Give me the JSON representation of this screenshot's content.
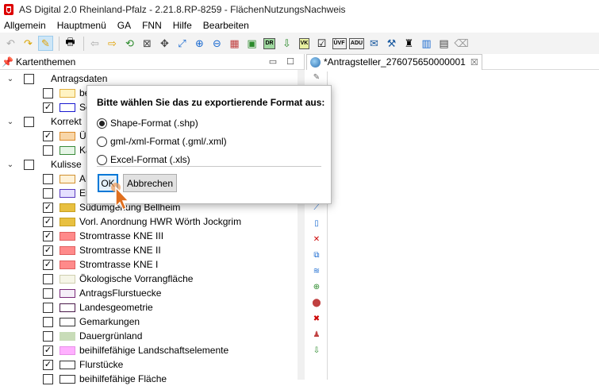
{
  "window": {
    "title": "AS Digital 2.0 Rheinland-Pfalz - 2.21.8.RP-8259 - FlächenNutzungsNachweis"
  },
  "menu": [
    "Allgemein",
    "Hauptmenü",
    "GA",
    "FNN",
    "Hilfe",
    "Bearbeiten"
  ],
  "toolbar": {
    "icons": [
      "undo-icon",
      "redo-icon",
      "pencil-icon",
      "print-icon",
      "back-icon",
      "forward-icon",
      "refresh-icon",
      "select-icon",
      "pan-icon",
      "fit-icon",
      "zoom-in-icon",
      "zoom-out-icon",
      "layers-icon",
      "colors-icon",
      "dr-icon",
      "export-icon",
      "vk-icon",
      "checklist-icon",
      "upload-icon",
      "adu-icon",
      "mail-icon",
      "tools-icon",
      "bug-icon",
      "map-icon",
      "save-icon",
      "eraser-icon"
    ],
    "badges": {
      "dr": "DR",
      "vk": "VK",
      "ouf": "ÜVF",
      "adu": "ADU"
    }
  },
  "left_panel": {
    "title": "Kartenthemen",
    "groups": [
      {
        "label": "Antragsdaten",
        "checked": false
      },
      {
        "label": "Korrekt",
        "checked": false
      },
      {
        "label": "Kulisse",
        "checked": false
      }
    ],
    "items": [
      {
        "label": "be",
        "checked": false,
        "color": "#fff3c2",
        "border": "#e0b040"
      },
      {
        "label": "Sc",
        "checked": true,
        "color": "#ffffff",
        "border": "#1a1ad0"
      },
      {
        "label": "Üb",
        "checked": true,
        "color": "#f8d6a8",
        "border": "#d98a2a"
      },
      {
        "label": "Ka",
        "checked": false,
        "color": "#e6f5e6",
        "border": "#3a8a3a"
      },
      {
        "label": "AU",
        "checked": false,
        "color": "#fff2d8",
        "border": "#d09030"
      },
      {
        "label": "Er",
        "checked": false,
        "color": "#e5e0ff",
        "border": "#5a3abf"
      },
      {
        "label": "Südumgehung Bellheim",
        "checked": true,
        "color": "#e8c040",
        "border": "#c8a020"
      },
      {
        "label": "Vorl. Anordnung HWR Wörth Jockgrim",
        "checked": true,
        "color": "#e8c040",
        "border": "#c8a020"
      },
      {
        "label": "Stromtrasse KNE III",
        "checked": true,
        "color": "#ff8a8a",
        "border": "#e06060"
      },
      {
        "label": "Stromtrasse KNE II",
        "checked": true,
        "color": "#ff8a8a",
        "border": "#e06060"
      },
      {
        "label": "Stromtrasse KNE I",
        "checked": true,
        "color": "#ff8a8a",
        "border": "#e06060"
      },
      {
        "label": "Ökologische Vorrangfläche",
        "checked": false,
        "color": "#f6f6e8",
        "border": "#cfcfb0"
      },
      {
        "label": "AntragsFlurstuecke",
        "checked": false,
        "color": "#f5eef8",
        "border": "#7a2a7a"
      },
      {
        "label": "Landesgeometrie",
        "checked": false,
        "color": "#ffffff",
        "border": "#4a1a4a"
      },
      {
        "label": "Gemarkungen",
        "checked": false,
        "color": "#ffffff",
        "border": "#333333"
      },
      {
        "label": "Dauergrünland",
        "checked": false,
        "color": "#c8dcb8",
        "border": "#c8dcb8"
      },
      {
        "label": "beihilfefähige Landschaftselemente",
        "checked": true,
        "color": "#ffb0ff",
        "border": "#e890e8"
      },
      {
        "label": "Flurstücke",
        "checked": true,
        "color": "#ffffff",
        "border": "#333333"
      },
      {
        "label": "beihilfefähige Fläche",
        "checked": false,
        "color": "#ffffff",
        "border": "#333333"
      }
    ]
  },
  "right_panel": {
    "tab_label": "*Antragsteller_276075650000001",
    "tab_close": "☒"
  },
  "dialog": {
    "prompt": "Bitte wählen Sie das zu exportierende Format aus:",
    "options": [
      {
        "label": "Shape-Format (.shp)",
        "selected": true
      },
      {
        "label": "gml-/xml-Format (.gml/.xml)",
        "selected": false
      },
      {
        "label": "Excel-Format (.xls)",
        "selected": false
      }
    ],
    "ok_label": "OK",
    "cancel_label": "Abbrechen"
  }
}
